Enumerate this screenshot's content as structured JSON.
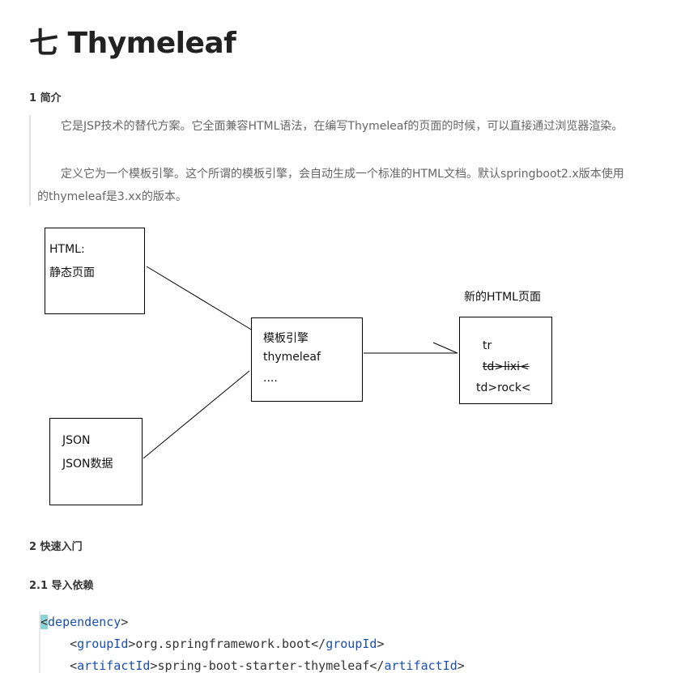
{
  "heading": {
    "title": "七 Thymeleaf"
  },
  "section1": {
    "title": "1 简介",
    "paragraphs": [
      "它是JSP技术的替代方案。它全面兼容HTML语法，在编写Thymeleaf的页面的时候，可以直接通过浏览器渲染。",
      "定义它为一个模板引擎。这个所谓的模板引擎，会自动生成一个标准的HTML文档。默认springboot2.x版本使用的thymeleaf是3.xx的版本。"
    ]
  },
  "diagram": {
    "html_box": {
      "line1": "HTML:",
      "line2": "静态页面"
    },
    "json_box": {
      "line1": "JSON",
      "line2": "JSON数据"
    },
    "engine_box": {
      "line1": "模板引擎",
      "line2": "thymeleaf",
      "line3": "...."
    },
    "result_label": "新的HTML页面",
    "result_box": {
      "line1": "tr",
      "line2": "td>lixi<",
      "line3": "td>rock<"
    }
  },
  "section2": {
    "title": "2 快速入门"
  },
  "section21": {
    "title": "2.1 导入依赖"
  },
  "code": {
    "dependency_tag": "dependency",
    "group_tag": "groupId",
    "group_value": "org.springframework.boot",
    "artifact_tag": "artifactId",
    "artifact_value": "spring-boot-starter-thymeleaf"
  }
}
